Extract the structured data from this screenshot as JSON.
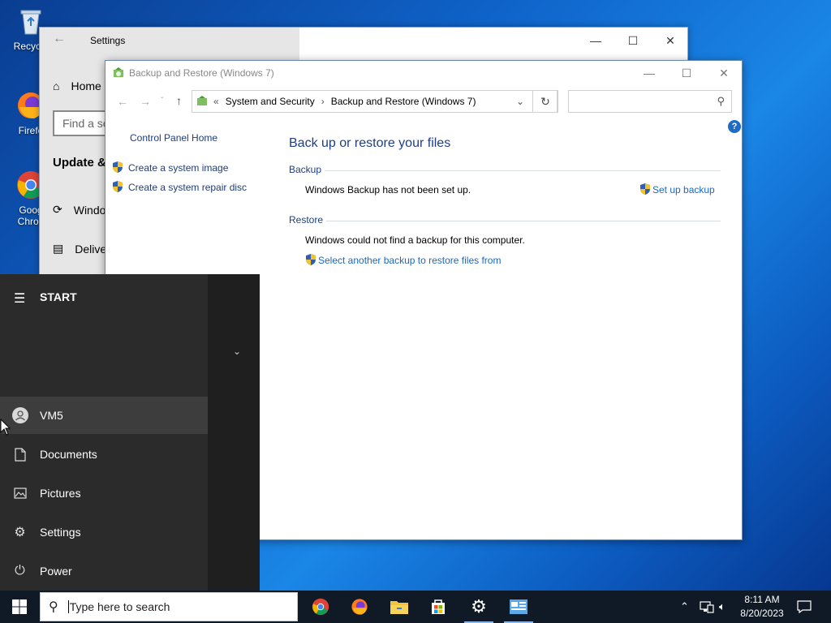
{
  "desktop": {
    "icons": [
      {
        "label": "Recycle"
      },
      {
        "label": "Firefo"
      },
      {
        "label": "Goog Chron"
      }
    ]
  },
  "settings_window": {
    "title": "Settings",
    "nav_home": "Home",
    "search_placeholder": "Find a se",
    "section": "Update & ",
    "nav_windows": "Windo",
    "nav_delivery": "Delive"
  },
  "cp_window": {
    "title": "Backup and Restore (Windows 7)",
    "breadcrumb": [
      "System and Security",
      "Backup and Restore (Windows 7)"
    ],
    "left_links": {
      "home": "Control Panel Home",
      "system_image": "Create a system image",
      "repair_disc": "Create a system repair disc"
    },
    "heading": "Back up or restore your files",
    "backup": {
      "label": "Backup",
      "status": "Windows Backup has not been set up.",
      "action": "Set up backup"
    },
    "restore": {
      "label": "Restore",
      "status": "Windows could not find a backup for this computer.",
      "action": "Select another backup to restore files from"
    },
    "help": "?"
  },
  "start_menu": {
    "title": "START",
    "items": [
      {
        "label": "VM5",
        "icon": "user-icon"
      },
      {
        "label": "Documents",
        "icon": "document-icon"
      },
      {
        "label": "Pictures",
        "icon": "pictures-icon"
      },
      {
        "label": "Settings",
        "icon": "gear-icon"
      },
      {
        "label": "Power",
        "icon": "power-icon"
      }
    ]
  },
  "taskbar": {
    "search_placeholder": "Type here to search",
    "time": "8:11 AM",
    "date": "8/20/2023"
  },
  "colors": {
    "link": "#1a68c4",
    "heading": "#1e3f84",
    "taskbar": "#101a26",
    "start_bg": "#2b2b2b"
  }
}
